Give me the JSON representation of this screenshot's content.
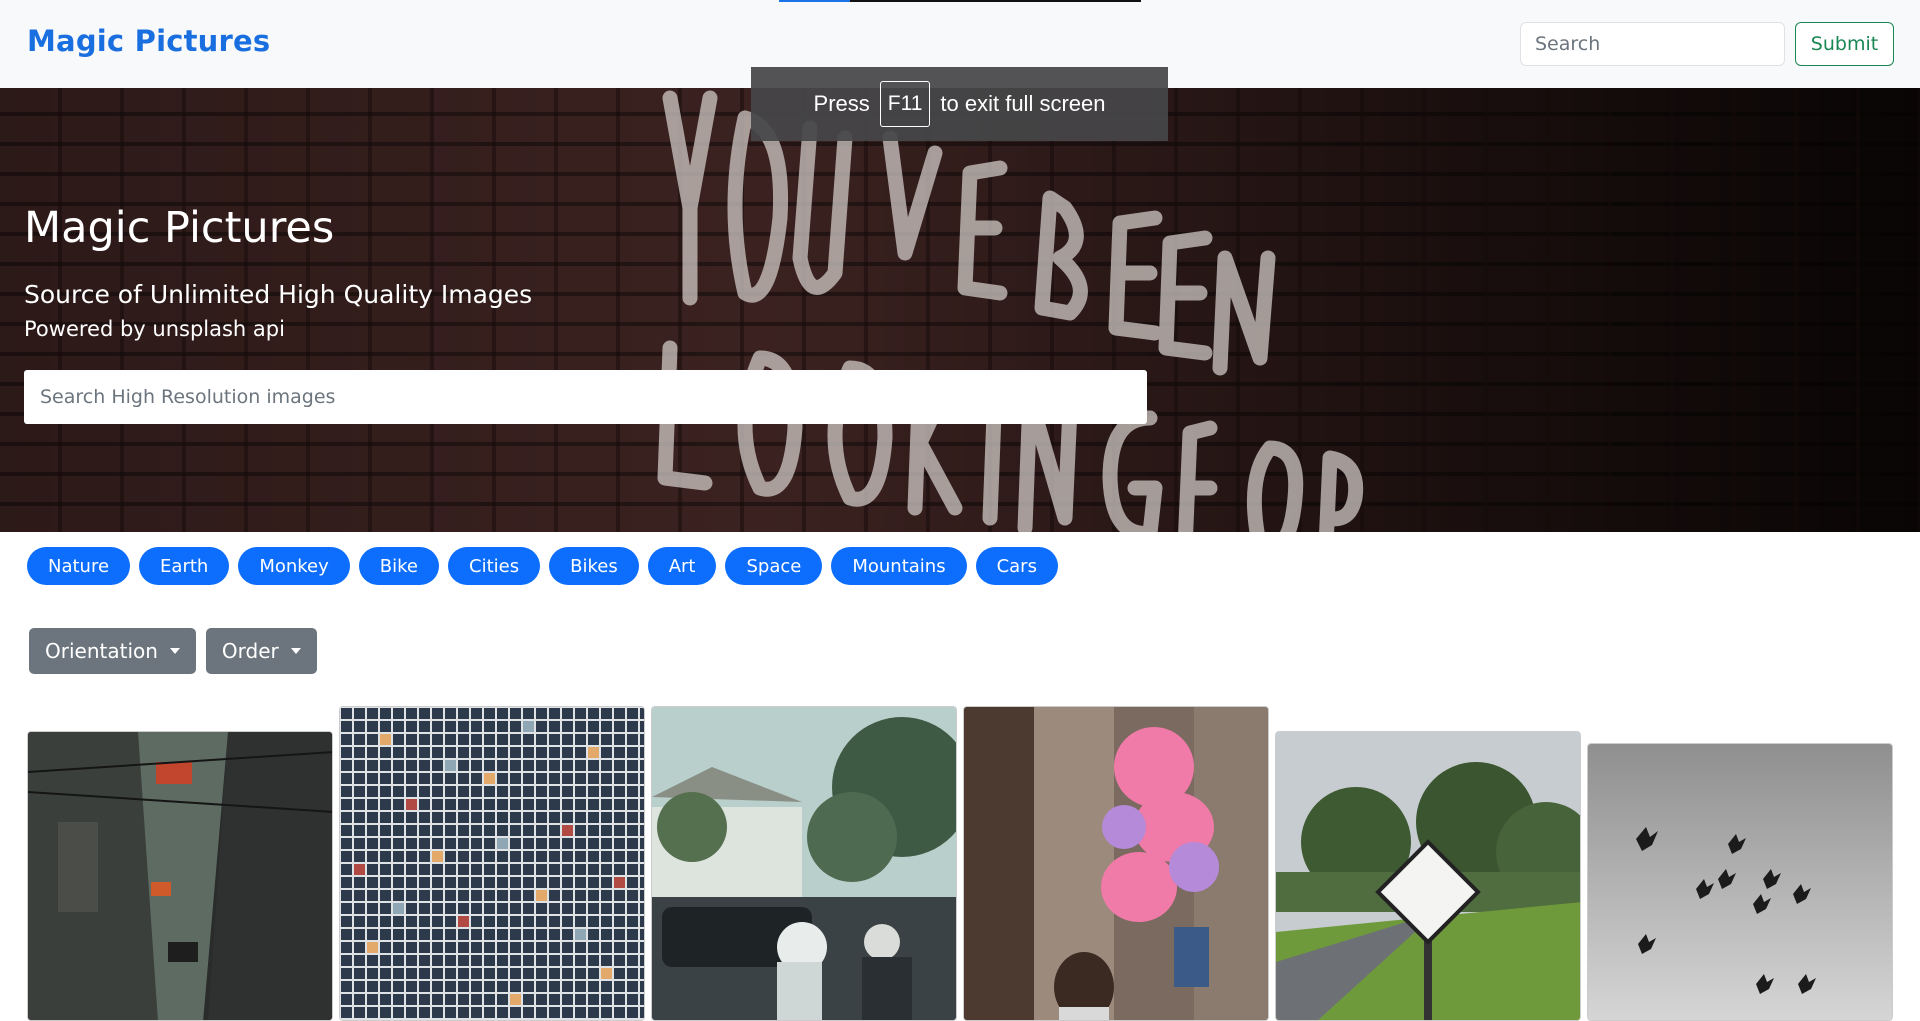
{
  "navbar": {
    "brand": "Magic Pictures",
    "search_placeholder": "Search",
    "submit_label": "Submit"
  },
  "fullscreen_toast": {
    "prefix": "Press",
    "key": "F11",
    "suffix": "to exit full screen"
  },
  "hero": {
    "title": "Magic Pictures",
    "subtitle": "Source of Unlimited High Quality Images",
    "powered_by": "Powered by unsplash api",
    "search_placeholder": "Search High Resolution images"
  },
  "tags": [
    "Nature",
    "Earth",
    "Monkey",
    "Bike",
    "Cities",
    "Bikes",
    "Art",
    "Space",
    "Mountains",
    "Cars"
  ],
  "filters": {
    "orientation_label": "Orientation",
    "order_label": "Order"
  },
  "colors": {
    "brand": "#1a6fe0",
    "tag_bg": "#0d6efd",
    "submit_green": "#198754",
    "dropdown_gray": "#6c757d"
  }
}
